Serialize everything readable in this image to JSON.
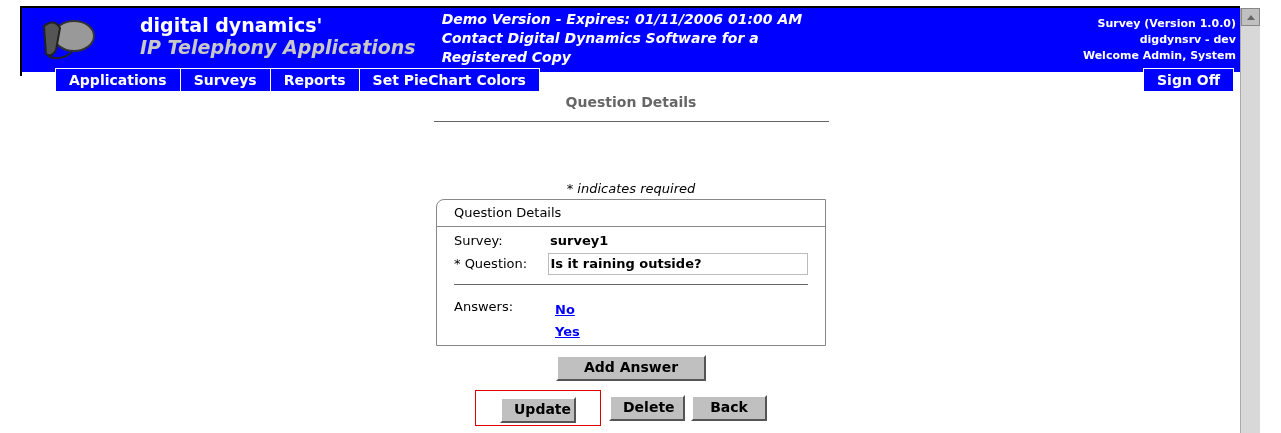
{
  "header": {
    "brand": "digital dynamics'",
    "product": "IP Telephony Applications",
    "demo_notice": [
      "Demo Version - Expires: 01/11/2006 01:00 AM",
      "Contact Digital Dynamics Software for a",
      "Registered Copy"
    ],
    "app_info": [
      "Survey (Version 1.0.0)",
      "digdynsrv - dev",
      "Welcome Admin, System"
    ]
  },
  "nav": {
    "items": [
      "Applications",
      "Surveys",
      "Reports",
      "Set PieChart Colors"
    ],
    "sign_off": "Sign Off"
  },
  "page_title": "Question Details",
  "required_note": "* indicates required",
  "panel": {
    "title": "Question Details",
    "survey_label": "Survey:",
    "survey_value": "survey1",
    "question_label": "* Question:",
    "question_value": "Is it raining outside?",
    "answers_label": "Answers:",
    "answers": [
      "No",
      "Yes"
    ]
  },
  "add_answer": "Add Answer",
  "buttons": [
    {
      "label": "Update",
      "highlighted": true
    },
    {
      "label": "Delete",
      "highlighted": false
    },
    {
      "label": "Back",
      "highlighted": false
    }
  ]
}
